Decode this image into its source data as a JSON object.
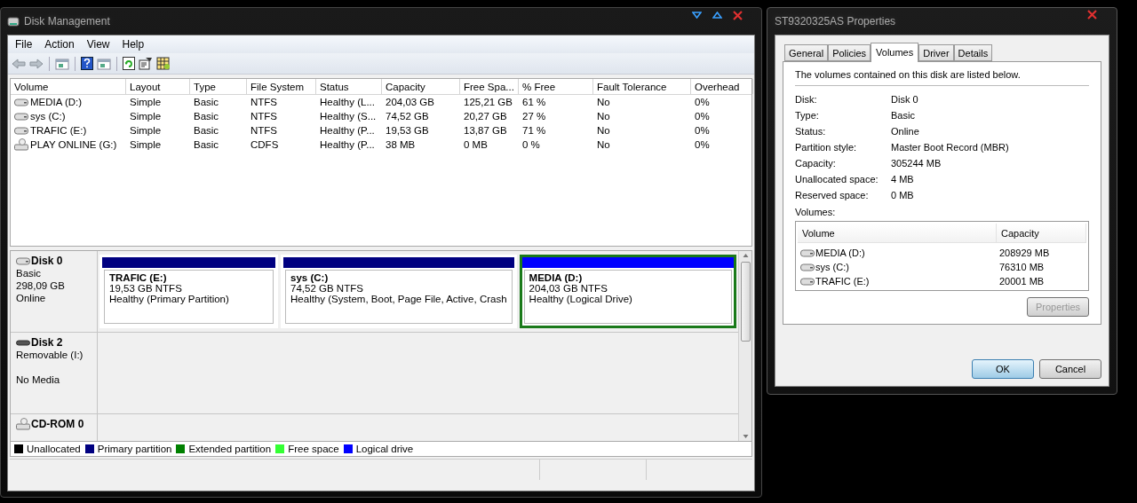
{
  "main_window": {
    "title": "Disk Management",
    "menu": [
      "File",
      "Action",
      "View",
      "Help"
    ],
    "table": {
      "columns": [
        "Volume",
        "Layout",
        "Type",
        "File System",
        "Status",
        "Capacity",
        "Free Spa...",
        "% Free",
        "Fault Tolerance",
        "Overhead"
      ],
      "rows": [
        {
          "kind": "hdd",
          "cells": [
            "MEDIA (D:)",
            "Simple",
            "Basic",
            "NTFS",
            "Healthy (L...",
            "204,03 GB",
            "125,21 GB",
            "61 %",
            "No",
            "0%"
          ]
        },
        {
          "kind": "hdd",
          "cells": [
            "sys (C:)",
            "Simple",
            "Basic",
            "NTFS",
            "Healthy (S...",
            "74,52 GB",
            "20,27 GB",
            "27 %",
            "No",
            "0%"
          ]
        },
        {
          "kind": "hdd",
          "cells": [
            "TRAFIC (E:)",
            "Simple",
            "Basic",
            "NTFS",
            "Healthy (P...",
            "19,53 GB",
            "13,87 GB",
            "71 %",
            "No",
            "0%"
          ]
        },
        {
          "kind": "cd",
          "cells": [
            "PLAY ONLINE (G:)",
            "Simple",
            "Basic",
            "CDFS",
            "Healthy (P...",
            "38 MB",
            "0 MB",
            "0 %",
            "No",
            "0%"
          ]
        }
      ]
    },
    "disks": [
      {
        "kind": "hdd",
        "name": "Disk 0",
        "lines": [
          "Basic",
          "298,09 GB",
          "Online"
        ],
        "partitions": [
          {
            "name": "TRAFIC  (E:)",
            "size": "19,53 GB NTFS",
            "status": "Healthy (Primary Partition)",
            "color": "#000080",
            "selected": false
          },
          {
            "name": "sys  (C:)",
            "size": "74,52 GB NTFS",
            "status": "Healthy (System, Boot, Page File, Active, Crash",
            "color": "#000080",
            "selected": false
          },
          {
            "name": "MEDIA  (D:)",
            "size": "204,03 GB NTFS",
            "status": "Healthy (Logical Drive)",
            "color": "#0000ff",
            "selected": true
          }
        ]
      },
      {
        "kind": "removable",
        "name": "Disk 2",
        "lines": [
          "Removable (I:)",
          "No Media"
        ]
      },
      {
        "kind": "cdrom",
        "name": "CD-ROM 0"
      }
    ],
    "legend": [
      {
        "label": "Unallocated",
        "color": "#000000"
      },
      {
        "label": "Primary partition",
        "color": "#000080"
      },
      {
        "label": "Extended partition",
        "color": "#008000"
      },
      {
        "label": "Free space",
        "color": "#33ff33"
      },
      {
        "label": "Logical drive",
        "color": "#0000ff"
      }
    ]
  },
  "dialog": {
    "title": "ST9320325AS Properties",
    "tabs": [
      {
        "label": "General",
        "selected": false
      },
      {
        "label": "Policies",
        "selected": false
      },
      {
        "label": "Volumes",
        "selected": true
      },
      {
        "label": "Driver",
        "selected": false
      },
      {
        "label": "Details",
        "selected": false
      }
    ],
    "intro": "The volumes contained on this disk are listed below.",
    "fields": [
      {
        "label": "Disk:",
        "value": "Disk 0"
      },
      {
        "label": "Type:",
        "value": "Basic"
      },
      {
        "label": "Status:",
        "value": "Online"
      },
      {
        "label": "Partition style:",
        "value": "Master Boot Record (MBR)"
      },
      {
        "label": "Capacity:",
        "value": "305244 MB"
      },
      {
        "label": "Unallocated space:",
        "value": "4 MB"
      },
      {
        "label": "Reserved space:",
        "value": "0 MB"
      }
    ],
    "volumes_label": "Volumes:",
    "volumes": {
      "columns": [
        "Volume",
        "Capacity"
      ],
      "rows": [
        [
          "MEDIA (D:)",
          "208929 MB"
        ],
        [
          "sys (C:)",
          "76310 MB"
        ],
        [
          "TRAFIC (E:)",
          "20001 MB"
        ]
      ]
    },
    "properties_button": {
      "label": "Properties",
      "disabled": true
    },
    "buttons": [
      {
        "label": "OK",
        "default": true
      },
      {
        "label": "Cancel",
        "default": false
      }
    ]
  }
}
